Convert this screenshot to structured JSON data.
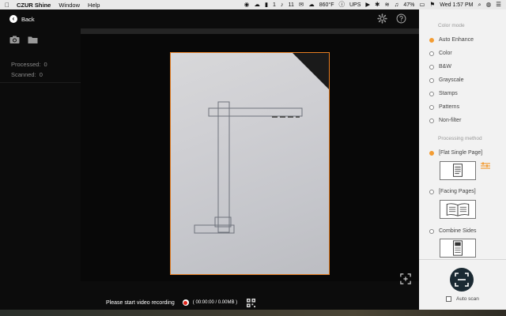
{
  "menubar": {
    "app_name": "CZUR Shine",
    "menus": [
      "Window",
      "Help"
    ],
    "tray_one": "1",
    "tray_eleven": "11",
    "tray_temp": "860°F",
    "tray_ups": "UPS",
    "battery": "47%",
    "datetime": "Wed 1:57 PM"
  },
  "toolbar": {
    "back_label": "Back"
  },
  "left": {
    "processed_label": "Processed:",
    "processed_value": "0",
    "scanned_label": "Scanned:",
    "scanned_value": "0"
  },
  "status": {
    "message": "Please start video recording",
    "time": "( 00:00:00 / 0.00MB )"
  },
  "settings": {
    "color_mode_title": "Color mode",
    "color_modes": [
      "Auto Enhance",
      "Color",
      "B&W",
      "Grayscale",
      "Stamps",
      "Patterns",
      "Non-filter"
    ],
    "selected_color_mode": "Auto Enhance",
    "processing_title": "Processing method",
    "methods": [
      "[Flat Single Page]",
      "[Facing Pages]",
      "Combine Sides"
    ],
    "selected_method": "[Flat Single Page]",
    "auto_scan_label": "Auto scan",
    "auto_scan_checked": false
  },
  "colors": {
    "accent": "#f39c33",
    "crop_border": "#e67e22",
    "record": "#e0241b",
    "scan_button": "#1b2a33"
  }
}
